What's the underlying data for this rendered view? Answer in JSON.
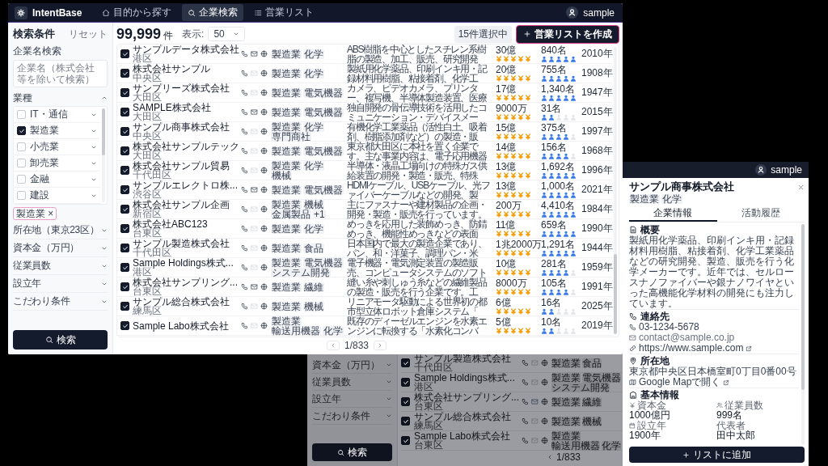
{
  "front_window": {
    "header": {
      "logo": "IntentBase",
      "nav": [
        {
          "label": "目的から探す",
          "selected": false
        },
        {
          "label": "企業検索",
          "selected": true
        },
        {
          "label": "営業リスト",
          "selected": false
        }
      ],
      "user": "sample"
    },
    "sidebar": {
      "title": "検索条件",
      "reset": "リセット",
      "name_search": {
        "label": "企業名検索",
        "placeholder": "企業名（株式会社等を除いて検索）"
      },
      "industry": {
        "label": "業種",
        "expanded": true,
        "options": [
          {
            "label": "IT・通信",
            "checked": false
          },
          {
            "label": "製造業",
            "checked": true
          },
          {
            "label": "小売業",
            "checked": false
          },
          {
            "label": "卸売業",
            "checked": false
          },
          {
            "label": "金融",
            "checked": false
          },
          {
            "label": "建設",
            "checked": false
          }
        ]
      },
      "chips": [
        {
          "label": "製造業",
          "remove": "×"
        }
      ],
      "sections": [
        {
          "label": "所在地（東京23区）",
          "expanded": false
        },
        {
          "label": "資本金（万円）",
          "expanded": false
        },
        {
          "label": "従業員数",
          "expanded": false
        },
        {
          "label": "設立年",
          "expanded": false
        },
        {
          "label": "こだわり条件",
          "expanded": false
        }
      ],
      "search_button": "検索"
    },
    "results": {
      "count": "99,999",
      "unit": "件",
      "per_page_label": "表示:",
      "per_page": "50",
      "selected_count": "15件選択中",
      "create_button": "営業リストを作成",
      "rows": [
        {
          "checked": true,
          "name": "サンプルデータ株式会社",
          "area": "港区",
          "email": true,
          "tags": [
            "製造業",
            "化学"
          ],
          "description": "ABS樹脂を中心としたスチレン系樹脂の製造、加工、販売、研究開発",
          "capital": {
            "value": "30億",
            "stars": 5
          },
          "employees": {
            "value": "840名",
            "stars": 5
          },
          "founded": "2010年"
        },
        {
          "checked": true,
          "name": "株式会社サンプル",
          "area": "中央区",
          "email": false,
          "tags": [
            "製造業",
            "化学"
          ],
          "description": "製紙用化学薬品、印刷インキ用・記録材料用樹脂、粘接着剤、化学工",
          "capital": {
            "value": "20億",
            "stars": 5
          },
          "employees": {
            "value": "755名",
            "stars": 5
          },
          "founded": "1908年"
        },
        {
          "checked": true,
          "name": "サンプリーズ株式会社",
          "area": "大田区",
          "email": false,
          "tags": [
            "製造業",
            "電気機器"
          ],
          "description": "カメラ、ビデオカメラ、プリンター、複写機、半導体製造装置、医療",
          "capital": {
            "value": "17億",
            "stars": 5
          },
          "employees": {
            "value": "1,340名",
            "stars": 5
          },
          "founded": "1947年"
        },
        {
          "checked": true,
          "name": "SAMPLE株式会社",
          "area": "大田区",
          "email": true,
          "tags": [
            "製造業",
            "電気機器"
          ],
          "description": "独自開発の骨伝導技術を活用したコミュニケーション・デバイスメー",
          "capital": {
            "value": "9000万",
            "stars": 5
          },
          "employees": {
            "value": "31名",
            "stars": 2
          },
          "founded": "2015年"
        },
        {
          "checked": true,
          "name": "サンプル商事株式会社",
          "area": "中央区",
          "email": false,
          "tags": [
            "製造業",
            "化学",
            "専門商社"
          ],
          "description": "有機化学工業薬品（活性白土、吸着剤、樹脂添加剤など）の製造・販",
          "capital": {
            "value": "15億",
            "stars": 5
          },
          "employees": {
            "value": "375名",
            "stars": 4
          },
          "founded": "1997年"
        },
        {
          "checked": true,
          "name": "株式会社サンプルテック",
          "area": "大田区",
          "email": false,
          "tags": [
            "製造業",
            "電気機器"
          ],
          "description": "東京都大田区に本社を置く企業です。主な事業内容は、電子応用機器",
          "capital": {
            "value": "14億",
            "stars": 5
          },
          "employees": {
            "value": "156名",
            "stars": 4
          },
          "founded": "1968年"
        },
        {
          "checked": true,
          "name": "株式会社サンプル貿易",
          "area": "千代田区",
          "email": false,
          "tags": [
            "製造業",
            "化学",
            "機械"
          ],
          "description": "半導体・液晶工場向けの特殊ガス供給装置の開発・製造・販売、特殊",
          "capital": {
            "value": "13億",
            "stars": 5
          },
          "employees": {
            "value": "1,692名",
            "stars": 5
          },
          "founded": "1996年"
        },
        {
          "checked": true,
          "name": "サンプルエレクトロ株...",
          "area": "渋谷区",
          "email": true,
          "tags": [
            "製造業",
            "電気機器"
          ],
          "description": "HDMIケーブル、USBケーブル、光ファイバーケーブルなどの開発、製",
          "capital": {
            "value": "13億",
            "stars": 5
          },
          "employees": {
            "value": "1,000名",
            "stars": 5
          },
          "founded": "2021年"
        },
        {
          "checked": true,
          "name": "株式会社サンプル企画",
          "area": "新宿区",
          "email": false,
          "tags": [
            "製造業",
            "機械",
            "金属製品",
            "+1"
          ],
          "description": "主にファスナーや建材製品の企画・開発・製造・販売を行っています。",
          "capital": {
            "value": "200万",
            "stars": 5
          },
          "employees": {
            "value": "4,410名",
            "stars": 5
          },
          "founded": "1984年"
        },
        {
          "checked": true,
          "name": "株式会社ABC123",
          "area": "台東区",
          "email": false,
          "tags": [
            "製造業",
            "化学"
          ],
          "description": "めっきを応用した装飾めっき、防錆めっき、機能性めっきなどの表面",
          "capital": {
            "value": "11億",
            "stars": 5
          },
          "employees": {
            "value": "659名",
            "stars": 5
          },
          "founded": "1990年"
        },
        {
          "checked": true,
          "name": "サンプル製造株式会社",
          "area": "千代田区",
          "email": false,
          "tags": [
            "製造業",
            "食品"
          ],
          "description": "日本国内で最大の製造企業であり、パン、和・洋菓子、調理パン・米",
          "capital": {
            "value": "1兆2000万",
            "stars": 5
          },
          "employees": {
            "value": "1,291名",
            "stars": 5
          },
          "founded": "1944年"
        },
        {
          "checked": true,
          "name": "Sample Holdings株式...",
          "area": "港区",
          "email": false,
          "tags": [
            "製造業",
            "電気機器",
            "システム開発"
          ],
          "description": "電子機器・電気測定装置の製造販売、コンピュータシステムのソフト",
          "capital": {
            "value": "10億",
            "stars": 5
          },
          "employees": {
            "value": "281名",
            "stars": 4
          },
          "founded": "1959年"
        },
        {
          "checked": true,
          "name": "株式会社サンプリング...",
          "area": "台東区",
          "email": true,
          "tags": [
            "製造業",
            "繊維"
          ],
          "description": "縫い糸や刺しゅう糸などの繊維製品の製造・販売を行う企業です。工",
          "capital": {
            "value": "8000万",
            "stars": 5
          },
          "employees": {
            "value": "105名",
            "stars": 4
          },
          "founded": "1991年"
        },
        {
          "checked": true,
          "name": "サンプル総合株式会社",
          "area": "練馬区",
          "email": false,
          "tags": [
            "製造業",
            "機械"
          ],
          "description": "リニアモータ駆動による世界初の都市型立体ロボット倉庫システム「",
          "capital": {
            "value": "6億",
            "stars": 5
          },
          "employees": {
            "value": "16名",
            "stars": 2
          },
          "founded": "2025年"
        },
        {
          "checked": true,
          "name": "Sample Labo株式会社",
          "email": false,
          "tags": [
            "製造業",
            "輸送用機器",
            "化学"
          ],
          "description": "既存のディーゼルエンジンを水素エンジンに転換する「水素化コンバ",
          "capital": {
            "value": "5億",
            "stars": 5
          },
          "employees": {
            "value": "10名",
            "stars": 2
          },
          "founded": "2019年"
        }
      ],
      "pagination": "1/833"
    }
  },
  "back_window": {
    "user": "sample",
    "sidebar_sections": [
      {
        "label": "資本金（万円）",
        "expanded": false
      },
      {
        "label": "従業員数",
        "expanded": false
      },
      {
        "label": "設立年",
        "expanded": false
      },
      {
        "label": "こだわり条件",
        "expanded": false
      }
    ],
    "search_button": "検索",
    "rows": [
      {
        "checked": true,
        "name": "サンプル製造株式会社",
        "area": "千代田区",
        "email": false,
        "tags": [
          "製造業",
          "食品"
        ]
      },
      {
        "checked": true,
        "name": "Sample Holdings株式...",
        "area": "港区",
        "email": false,
        "tags": [
          "製造業",
          "電気機器",
          "システム開発"
        ]
      },
      {
        "checked": true,
        "name": "株式会社サンプリング...",
        "area": "台東区",
        "email": true,
        "tags": [
          "製造業",
          "繊維"
        ]
      },
      {
        "checked": true,
        "name": "サンプル総合株式会社",
        "area": "練馬区",
        "email": false,
        "tags": [
          "製造業",
          "機械"
        ]
      },
      {
        "checked": true,
        "name": "Sample Labo株式会社",
        "area": "台東区",
        "email": false,
        "tags": [
          "製造業",
          "輸送用機器",
          "化学"
        ]
      }
    ],
    "pagination": "1/833",
    "detail": {
      "title": "サンプル商事株式会社",
      "tags": [
        "製造業",
        "化学"
      ],
      "tabs": [
        {
          "label": "企業情報",
          "selected": true
        },
        {
          "label": "活動履歴",
          "selected": false
        }
      ],
      "overview": {
        "heading": "概要",
        "text": "製紙用化学薬品、印刷インキ用・記録材料用樹脂、粘接着剤、化学工業薬品などの研究開発、製造、販売を行う化学メーカーです。近年では、セルロースナノファイバーや銀ナノワイヤといった高機能化学材料の開発にも注力しています。"
      },
      "contact": {
        "heading": "連絡先",
        "items": [
          {
            "kind": "phone",
            "text": "03-1234-5678"
          },
          {
            "kind": "email",
            "text": "contact@sample.co.jp"
          },
          {
            "kind": "url",
            "text": "https://www.sample.com"
          }
        ]
      },
      "location": {
        "heading": "所在地",
        "address": "東京都中央区日本橋室町0丁目0番00号",
        "map_link": "Google Mapで開く"
      },
      "basic": {
        "heading": "基本情報",
        "fields": [
          {
            "label": "資本金",
            "value": "1000億円"
          },
          {
            "label": "従業員数",
            "value": "999名"
          },
          {
            "label": "設立年",
            "value": "1900年"
          },
          {
            "label": "代表者",
            "value": "田中太郎"
          }
        ]
      },
      "add_button": "リストに追加"
    }
  }
}
